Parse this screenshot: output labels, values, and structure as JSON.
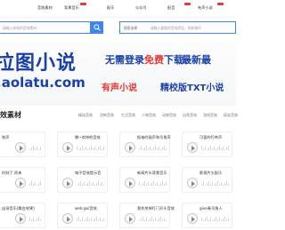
{
  "nav": {
    "items": [
      "音效素材",
      "背景音乐",
      "配乐",
      "公众号",
      "配音",
      "有声小说"
    ],
    "hot_items": [
      "精品",
      "视频"
    ]
  },
  "search": {
    "category_placeholder": "请输入你搜的音效素材",
    "secondary_select": "搜索选择",
    "secondary_placeholder": "请输入要搜的音效类型，例如掌声"
  },
  "banner": {
    "title": "拉图小说",
    "url": ".aolatu.com",
    "free_prefix": "无需登录",
    "free_highlight": "免费",
    "free_suffix": "下载",
    "latest": "最新最",
    "audio": "有声小说",
    "txt": "精校版TXT小说"
  },
  "section": {
    "title": "效素材",
    "tabs": [
      "精选音效",
      "恐怖音效",
      "生活音效",
      "人物音效",
      "动物音效",
      "自然音效",
      "游戏音效",
      "搞笑音效",
      "科技音效"
    ]
  },
  "cards": [
    {
      "name": "效声"
    },
    {
      "name": "嘟~欢快的音效"
    },
    {
      "name": "振奋的鼓声和号角声"
    },
    {
      "name": "可爱的叮咚声"
    },
    {
      "name": "时刻了 再来"
    },
    {
      "name": "电子音效提示音"
    },
    {
      "name": "新闻片头背景音乐"
    },
    {
      "name": "影视片头配乐"
    },
    {
      "name": "出场音乐(舞台效果)"
    },
    {
      "name": "web.goi音效"
    },
    {
      "name": "我先关掉打门开头音效"
    },
    {
      "name": "give奏号角人"
    }
  ],
  "colors": {
    "accent": "#3f86e8",
    "brand": "#1a3fa8",
    "highlight": "#e53935"
  }
}
